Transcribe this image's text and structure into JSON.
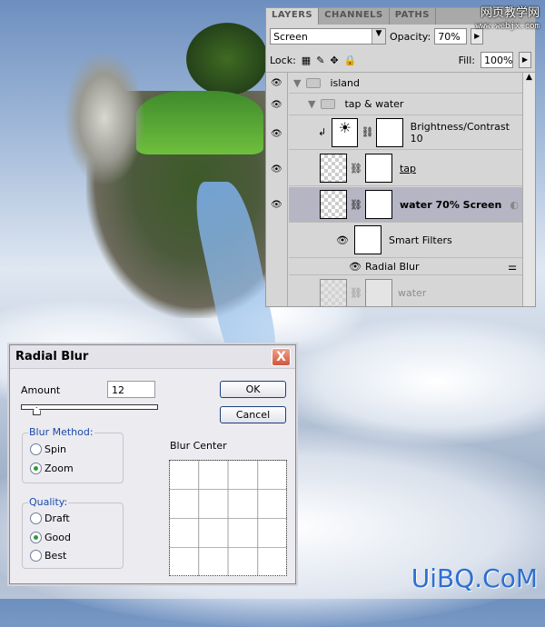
{
  "watermark_top": {
    "line1": "网页教学网",
    "line2": "www.webjx.com"
  },
  "watermark_bottom": "UiBQ.CoM",
  "layers_panel": {
    "tabs": [
      "LAYERS",
      "CHANNELS",
      "PATHS"
    ],
    "blend_mode": "Screen",
    "opacity_label": "Opacity:",
    "opacity": "70%",
    "lock_label": "Lock:",
    "fill_label": "Fill:",
    "fill": "100%",
    "layers": [
      {
        "name": "island",
        "type": "group"
      },
      {
        "name": "tap & water",
        "type": "group"
      },
      {
        "name": "Brightness/Contrast 10",
        "type": "adjustment"
      },
      {
        "name": "tap",
        "type": "smart-object"
      },
      {
        "name": "water 70% Screen",
        "type": "smart-object",
        "selected": true
      },
      {
        "name": "Smart Filters",
        "type": "filter-mask"
      },
      {
        "name": "Radial Blur",
        "type": "filter"
      },
      {
        "name": "water",
        "type": "smart-object"
      }
    ]
  },
  "dialog": {
    "title": "Radial Blur",
    "close": "X",
    "amount_label": "Amount",
    "amount": "12",
    "amount_range": [
      1,
      100
    ],
    "ok": "OK",
    "cancel": "Cancel",
    "blur_method_label": "Blur Method:",
    "blur_methods": [
      "Spin",
      "Zoom"
    ],
    "blur_method_selected": "Zoom",
    "quality_label": "Quality:",
    "qualities": [
      "Draft",
      "Good",
      "Best"
    ],
    "quality_selected": "Good",
    "blur_center_label": "Blur Center"
  }
}
